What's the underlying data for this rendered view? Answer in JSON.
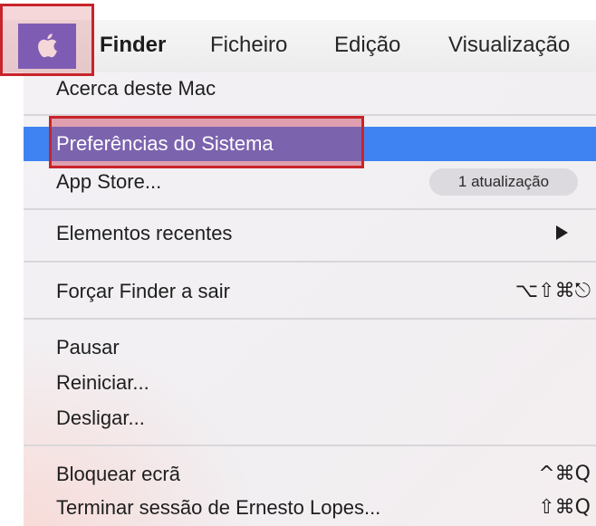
{
  "menubar": {
    "apple_icon": "apple-logo-icon",
    "items": [
      {
        "label": "Finder",
        "bold": true
      },
      {
        "label": "Ficheiro"
      },
      {
        "label": "Edição"
      },
      {
        "label": "Visualização"
      }
    ]
  },
  "menu": {
    "about": "Acerca deste Mac",
    "system_prefs": "Preferências do Sistema",
    "app_store": "App Store...",
    "app_store_badge": "1 atualização",
    "recent_items": "Elementos recentes",
    "recent_items_icon": "submenu-arrow-icon",
    "force_quit": "Forçar Finder a sair",
    "force_quit_shortcut": "⌥⇧⌘⎋",
    "sleep": "Pausar",
    "restart": "Reiniciar...",
    "shut_down": "Desligar...",
    "lock_screen": "Bloquear ecrã",
    "lock_screen_shortcut": "^⌘Q",
    "log_out": "Terminar sessão de Ernesto Lopes...",
    "log_out_shortcut": "⇧⌘Q"
  },
  "colors": {
    "highlight": "#3f83f2",
    "apple_box": "#6f6ad2",
    "annotation": "#c8242b"
  }
}
